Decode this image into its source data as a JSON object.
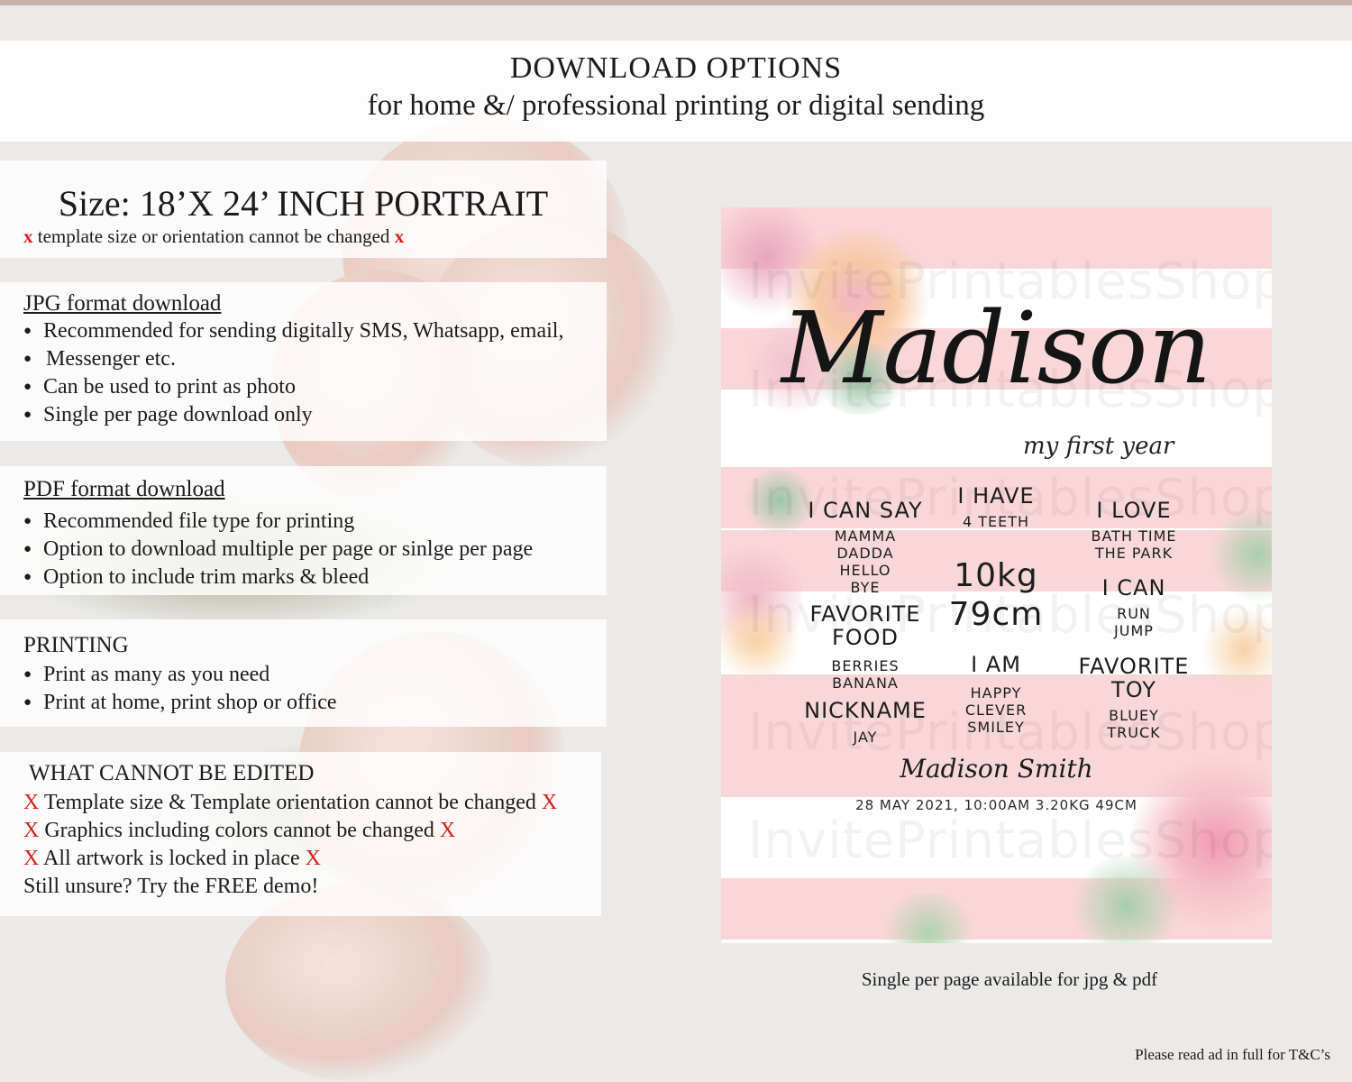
{
  "header": {
    "title": "DOWNLOAD OPTIONS",
    "subtitle": "for home &/ professional printing or digital sending"
  },
  "size": {
    "title": "Size: 18’X 24’ INCH PORTRAIT",
    "mark": "x",
    "note": "template size or orientation cannot be changed"
  },
  "jpg": {
    "title": "JPG format download",
    "bullets": [
      "Recommended for sending digitally SMS, Whatsapp, email,",
      "Can be used to print as photo",
      "Single per page download only"
    ],
    "continuation": "Messenger etc."
  },
  "pdf": {
    "title": "PDF format download",
    "bullets": [
      "Recommended file type for printing",
      "Option to download multiple per page or sinlge per page",
      "Option to include trim marks & bleed"
    ]
  },
  "printing": {
    "title": "PRINTING",
    "bullets": [
      "Print as many as you need",
      "Print at home, print shop or office"
    ]
  },
  "cannot_edit": {
    "title": "WHAT CANNOT BE EDITED",
    "mark": "X",
    "lines": [
      "Template size & Template orientation cannot be changed",
      "Graphics including colors cannot be changed",
      "All artwork is locked in place"
    ],
    "footer": "Still unsure? Try the FREE demo!"
  },
  "poster": {
    "name": "Madison",
    "subtitle": "my first year",
    "watermark": "InvitePrintablesShop",
    "can_say": {
      "title": "I CAN SAY",
      "lines": [
        "MAMMA",
        "DADDA",
        "HELLO",
        "BYE"
      ]
    },
    "have": {
      "title": "I HAVE",
      "value": "4 TEETH"
    },
    "love": {
      "title": "I LOVE",
      "lines": [
        "BATH TIME",
        "THE PARK"
      ]
    },
    "weight": "10kg",
    "height": "79cm",
    "can": {
      "title": "I CAN",
      "lines": [
        "RUN",
        "JUMP"
      ]
    },
    "food": {
      "title1": "FAVORITE",
      "title2": "FOOD",
      "lines": [
        "BERRIES",
        "BANANA"
      ]
    },
    "am": {
      "title": "I AM",
      "lines": [
        "HAPPY",
        "CLEVER",
        "SMILEY"
      ]
    },
    "toy": {
      "title1": "FAVORITE",
      "title2": "TOY",
      "lines": [
        "BLUEY",
        "TRUCK"
      ]
    },
    "nickname": {
      "title": "NICKNAME",
      "value": "JAY"
    },
    "signature": "Madison Smith",
    "birth": "28 MAY 2021, 10:00AM 3.20KG 49CM"
  },
  "caption": "Single per page available for jpg & pdf",
  "terms": "Please read ad in full for T&C’s",
  "colors": {
    "accent_red": "#d62020",
    "stripe_pink": "#f9d7d8",
    "background": "#ebeae8"
  }
}
